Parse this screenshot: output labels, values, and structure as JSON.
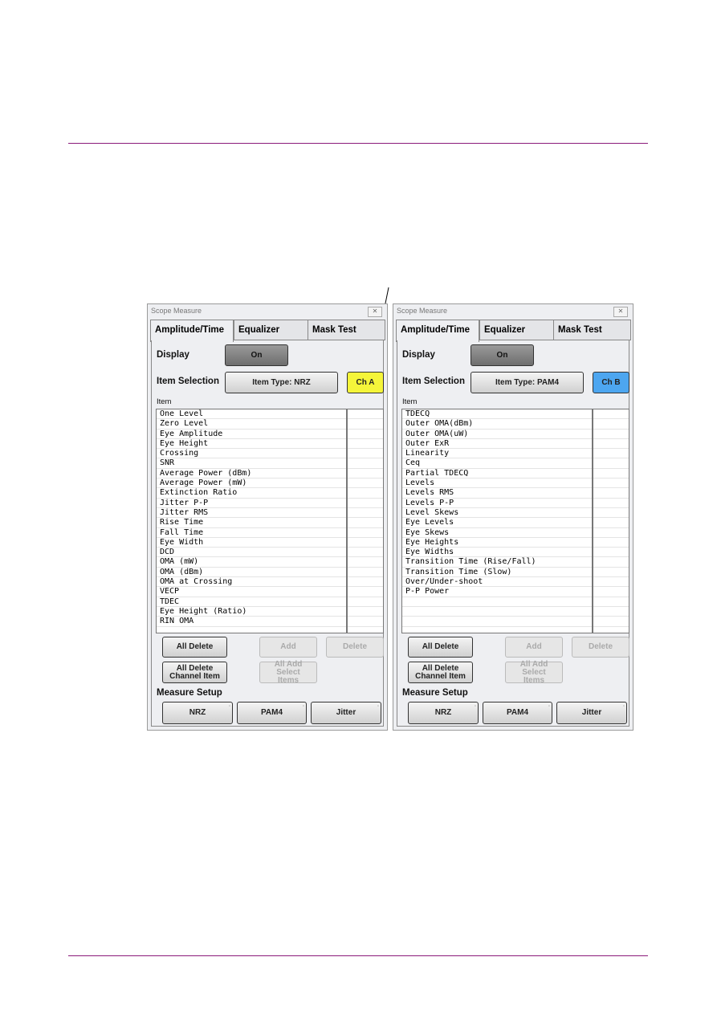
{
  "panels": [
    {
      "title": "Scope Measure",
      "tabs": [
        "Amplitude/Time",
        "Equalizer",
        "Mask Test"
      ],
      "display_label": "Display",
      "display_value": "On",
      "item_selection_label": "Item Selection",
      "item_type": "Item Type: NRZ",
      "channel": "Ch A",
      "channel_color": "#f5f53a",
      "item_label": "Item",
      "items": [
        "One Level",
        "Zero Level",
        "Eye Amplitude",
        "Eye Height",
        "Crossing",
        "SNR",
        "Average Power (dBm)",
        "Average Power (mW)",
        "Extinction Ratio",
        "Jitter P-P",
        "Jitter RMS",
        "Rise Time",
        "Fall Time",
        "Eye Width",
        "DCD",
        "OMA (mW)",
        "OMA (dBm)",
        "OMA at Crossing",
        "VECP",
        "TDEC",
        "Eye Height (Ratio)",
        "RIN OMA"
      ],
      "buttons": {
        "all_delete": "All Delete",
        "add": "Add",
        "delete": "Delete",
        "all_delete_channel": "All Delete Channel Item",
        "all_add": "All Add Select Items"
      },
      "measure_setup_label": "Measure Setup",
      "setup_buttons": [
        "NRZ",
        "PAM4",
        "Jitter"
      ]
    },
    {
      "title": "Scope Measure",
      "tabs": [
        "Amplitude/Time",
        "Equalizer",
        "Mask Test"
      ],
      "display_label": "Display",
      "display_value": "On",
      "item_selection_label": "Item Selection",
      "item_type": "Item Type: PAM4",
      "channel": "Ch B",
      "channel_color": "#4da6f0",
      "item_label": "Item",
      "items": [
        "TDECQ",
        "Outer OMA(dBm)",
        "Outer OMA(uW)",
        "Outer ExR",
        "Linearity",
        "Ceq",
        "Partial TDECQ",
        "Levels",
        "Levels RMS",
        "Levels P-P",
        "Level Skews",
        "Eye Levels",
        "Eye Skews",
        "Eye Heights",
        "Eye Widths",
        "Transition Time (Rise/Fall)",
        "Transition Time (Slow)",
        "Over/Under-shoot",
        "P-P Power"
      ],
      "buttons": {
        "all_delete": "All Delete",
        "add": "Add",
        "delete": "Delete",
        "all_delete_channel": "All Delete Channel Item",
        "all_add": "All Add Select Items"
      },
      "measure_setup_label": "Measure Setup",
      "setup_buttons": [
        "NRZ",
        "PAM4",
        "Jitter"
      ]
    }
  ]
}
